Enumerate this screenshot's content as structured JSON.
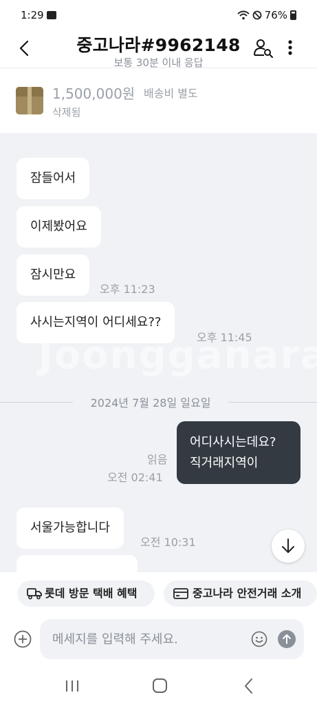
{
  "status_bar": {
    "time": "1:29",
    "battery": "76%",
    "icons": [
      "image-icon",
      "wifi-icon",
      "do-not-disturb-icon",
      "battery-icon"
    ]
  },
  "header": {
    "title": "중고나라#9962148",
    "subtitle": "보통 30분 이내 응답",
    "icons": [
      "back-arrow-icon",
      "profile-search-icon",
      "more-vertical-icon"
    ]
  },
  "product": {
    "price": "1,500,000원",
    "shipping": "배송비 별도",
    "status": "삭제됨"
  },
  "chat": {
    "watermark": "Joongganara",
    "messages": [
      {
        "text": "잠들어서",
        "time": ""
      },
      {
        "text": "이제봤어요",
        "time": ""
      },
      {
        "text": "잠시만요",
        "time": "오후 11:23"
      },
      {
        "text": "사시는지역이 어디세요??",
        "time": "오후 11:45"
      }
    ],
    "date_divider": "2024년 7월 28일 일요일",
    "my_message": {
      "line1": "어디사시는데요?",
      "line2": "직거래지역이",
      "read": "읽음",
      "time": "오전 02:41"
    },
    "later_messages": [
      {
        "text": "서울가능합니다",
        "time": "오전 10:31"
      }
    ]
  },
  "quick_actions": [
    {
      "label": "롯데 방문 택배 혜택",
      "icon": "truck-icon"
    },
    {
      "label": "중고나라 안전거래 소개",
      "icon": "card-icon"
    }
  ],
  "composer": {
    "placeholder": "메세지를 입력해 주세요.",
    "icons": [
      "plus-circle-icon",
      "emoji-icon",
      "send-arrow-icon"
    ]
  },
  "colors": {
    "chat_background": "#f0f2f5",
    "my_bubble": "#333a42",
    "muted_text": "#9aa0a8"
  }
}
